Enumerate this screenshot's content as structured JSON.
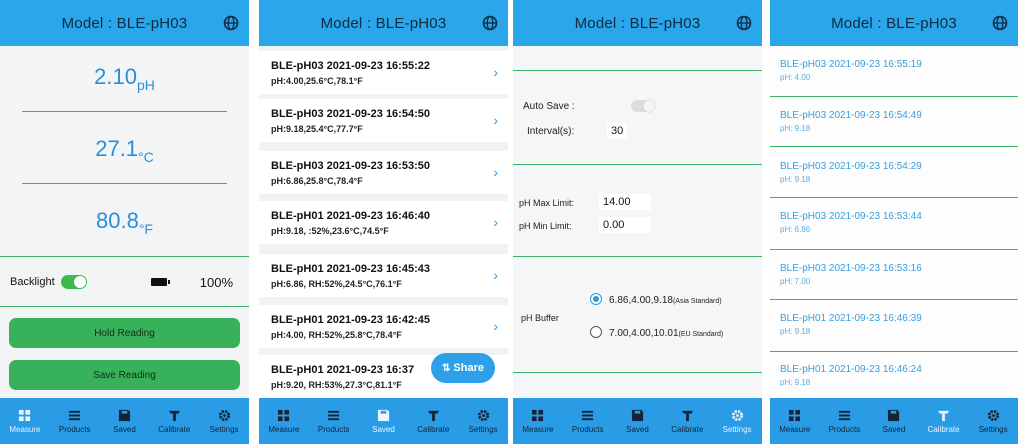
{
  "header": {
    "title": "Model : BLE-pH03",
    "globe_icon": "globe-icon"
  },
  "nav": [
    {
      "label": "Measure",
      "icon": "grid-icon"
    },
    {
      "label": "Products",
      "icon": "list-icon"
    },
    {
      "label": "Saved",
      "icon": "save-icon"
    },
    {
      "label": "Calibrate",
      "icon": "probe-icon"
    },
    {
      "label": "Settings",
      "icon": "gear-icon"
    }
  ],
  "measure": {
    "ph_value": "2.10",
    "ph_unit": "pH",
    "temp_c_value": "27.1",
    "temp_c_unit": "°C",
    "temp_f_value": "80.8",
    "temp_f_unit": "°F",
    "backlight_label": "Backlight",
    "backlight_on": true,
    "battery_pct": "100%",
    "hold_label": "Hold Reading",
    "save_label": "Save Reading"
  },
  "saved": {
    "records": [
      {
        "title": "BLE-pH03   2021-09-23 16:55:22",
        "detail": "pH:4.00,25.6°C,78.1°F"
      },
      {
        "title": "BLE-pH03   2021-09-23 16:54:50",
        "detail": "pH:9.18,25.4°C,77.7°F"
      },
      {
        "title": "BLE-pH03   2021-09-23 16:53:50",
        "detail": "pH:6.86,25.8°C,78.4°F"
      },
      {
        "title": "BLE-pH01   2021-09-23 16:46:40",
        "detail": "pH:9.18,      :52%,23.6°C,74.5°F"
      },
      {
        "title": "BLE-pH01   2021-09-23 16:45:43",
        "detail": "pH:6.86, RH:52%,24.5°C,76.1°F"
      },
      {
        "title": "BLE-pH01   2021-09-23 16:42:45",
        "detail": "pH:4.00, RH:52%,25.8°C,78.4°F"
      },
      {
        "title": "BLE-pH01   2021-09-23 16:37",
        "detail": "pH:9.20, RH:53%,27.3°C,81.1°F"
      }
    ],
    "share_label": "Share"
  },
  "settings": {
    "auto_save_label": "Auto Save :",
    "auto_save_on": false,
    "interval_label": "Interval(s):",
    "interval_value": "30",
    "ph_max_label": "pH Max Limit:",
    "ph_max_value": "14.00",
    "ph_min_label": "pH Min Limit:",
    "ph_min_value": "0.00",
    "ph_buffer_label": "pH Buffer",
    "buffer_option_1": "6.86,4.00,9.18",
    "buffer_option_1_note": "(Asia Standard)",
    "buffer_option_2": "7.00,4.00,10.01",
    "buffer_option_2_note": "(EU Standard)"
  },
  "calibrate": {
    "entries": [
      {
        "title": "BLE-pH03   2021-09-23 16:55:19",
        "detail": "pH: 4.00"
      },
      {
        "title": "BLE-pH03   2021-09-23 16:54:49",
        "detail": "pH: 9.18"
      },
      {
        "title": "BLE-pH03   2021-09-23 16:54:29",
        "detail": "pH: 9.18"
      },
      {
        "title": "BLE-pH03   2021-09-23 16:53:44",
        "detail": "pH: 6.86"
      },
      {
        "title": "BLE-pH03   2021-09-23 16:53:16",
        "detail": "pH: 7.00"
      },
      {
        "title": "BLE-pH01   2021-09-23 16:46:39",
        "detail": "pH: 9.18"
      },
      {
        "title": "BLE-pH01   2021-09-23 16:46:24",
        "detail": "pH: 9.18"
      }
    ]
  },
  "colors": {
    "accent": "#2aa6ea",
    "green": "#38b25a",
    "divider": "#3fb26a"
  }
}
